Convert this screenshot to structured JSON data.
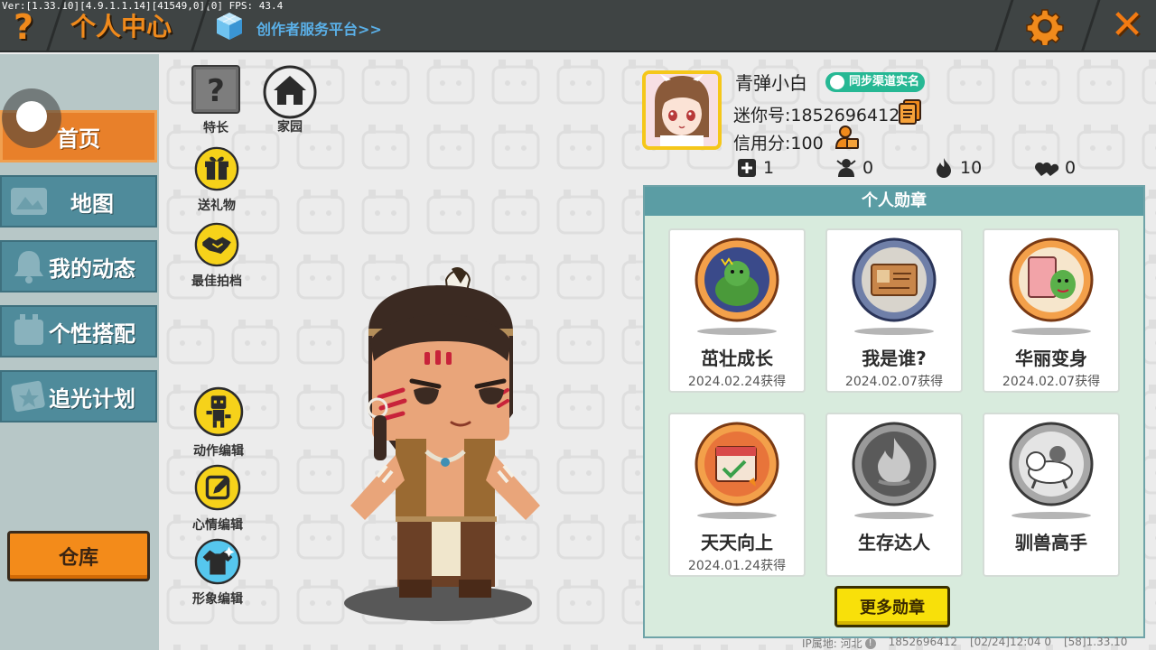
{
  "debug_text": "Ver:[1.33.10][4.9.1.1.14][41549,0][0] FPS: 43.4",
  "header": {
    "help_icon": "question-mark",
    "title": "个人中心",
    "creator_link": "创作者服务平台>>",
    "settings_icon": "gear",
    "close_icon": "close-x"
  },
  "sidebar": {
    "items": [
      {
        "label": "首页",
        "icon": "home",
        "active": true
      },
      {
        "label": "地图",
        "icon": "map",
        "active": false
      },
      {
        "label": "我的动态",
        "icon": "bell",
        "active": false
      },
      {
        "label": "个性搭配",
        "icon": "hanger",
        "active": false
      },
      {
        "label": "追光计划",
        "icon": "star-box",
        "active": false
      }
    ],
    "warehouse_label": "仓库"
  },
  "tools": {
    "specialty": "特长",
    "home": "家园",
    "send_gift": "送礼物",
    "best_photo": "最佳拍档",
    "action_edit": "动作编辑",
    "mood_edit": "心情编辑",
    "look_edit": "形象编辑"
  },
  "profile": {
    "name": "青弹小白",
    "verify_badge": "同步渠道实名",
    "mini_id": "迷你号:1852696412",
    "credit": "信用分:100",
    "stats": {
      "friends": "1",
      "followers": "0",
      "popularity": "10",
      "likes": "0"
    }
  },
  "medals": {
    "title": "个人勋章",
    "items": [
      {
        "name": "茁壮成长",
        "date": "2024.02.24获得",
        "icon": "green-dino-medal"
      },
      {
        "name": "我是谁?",
        "date": "2024.02.07获得",
        "icon": "id-card-medal"
      },
      {
        "name": "华丽变身",
        "date": "2024.02.07获得",
        "icon": "mirror-medal"
      },
      {
        "name": "天天向上",
        "date": "2024.01.24获得",
        "icon": "calendar-medal"
      },
      {
        "name": "生存达人",
        "date": "",
        "icon": "fire-medal"
      },
      {
        "name": "驯兽高手",
        "date": "",
        "icon": "beast-medal"
      }
    ],
    "more_label": "更多勋章"
  },
  "footer": {
    "ip_label": "IP属地: 河北",
    "uid": "1852696412",
    "time": "[02/24]12:04 0",
    "version": "[58]1.33.10"
  }
}
